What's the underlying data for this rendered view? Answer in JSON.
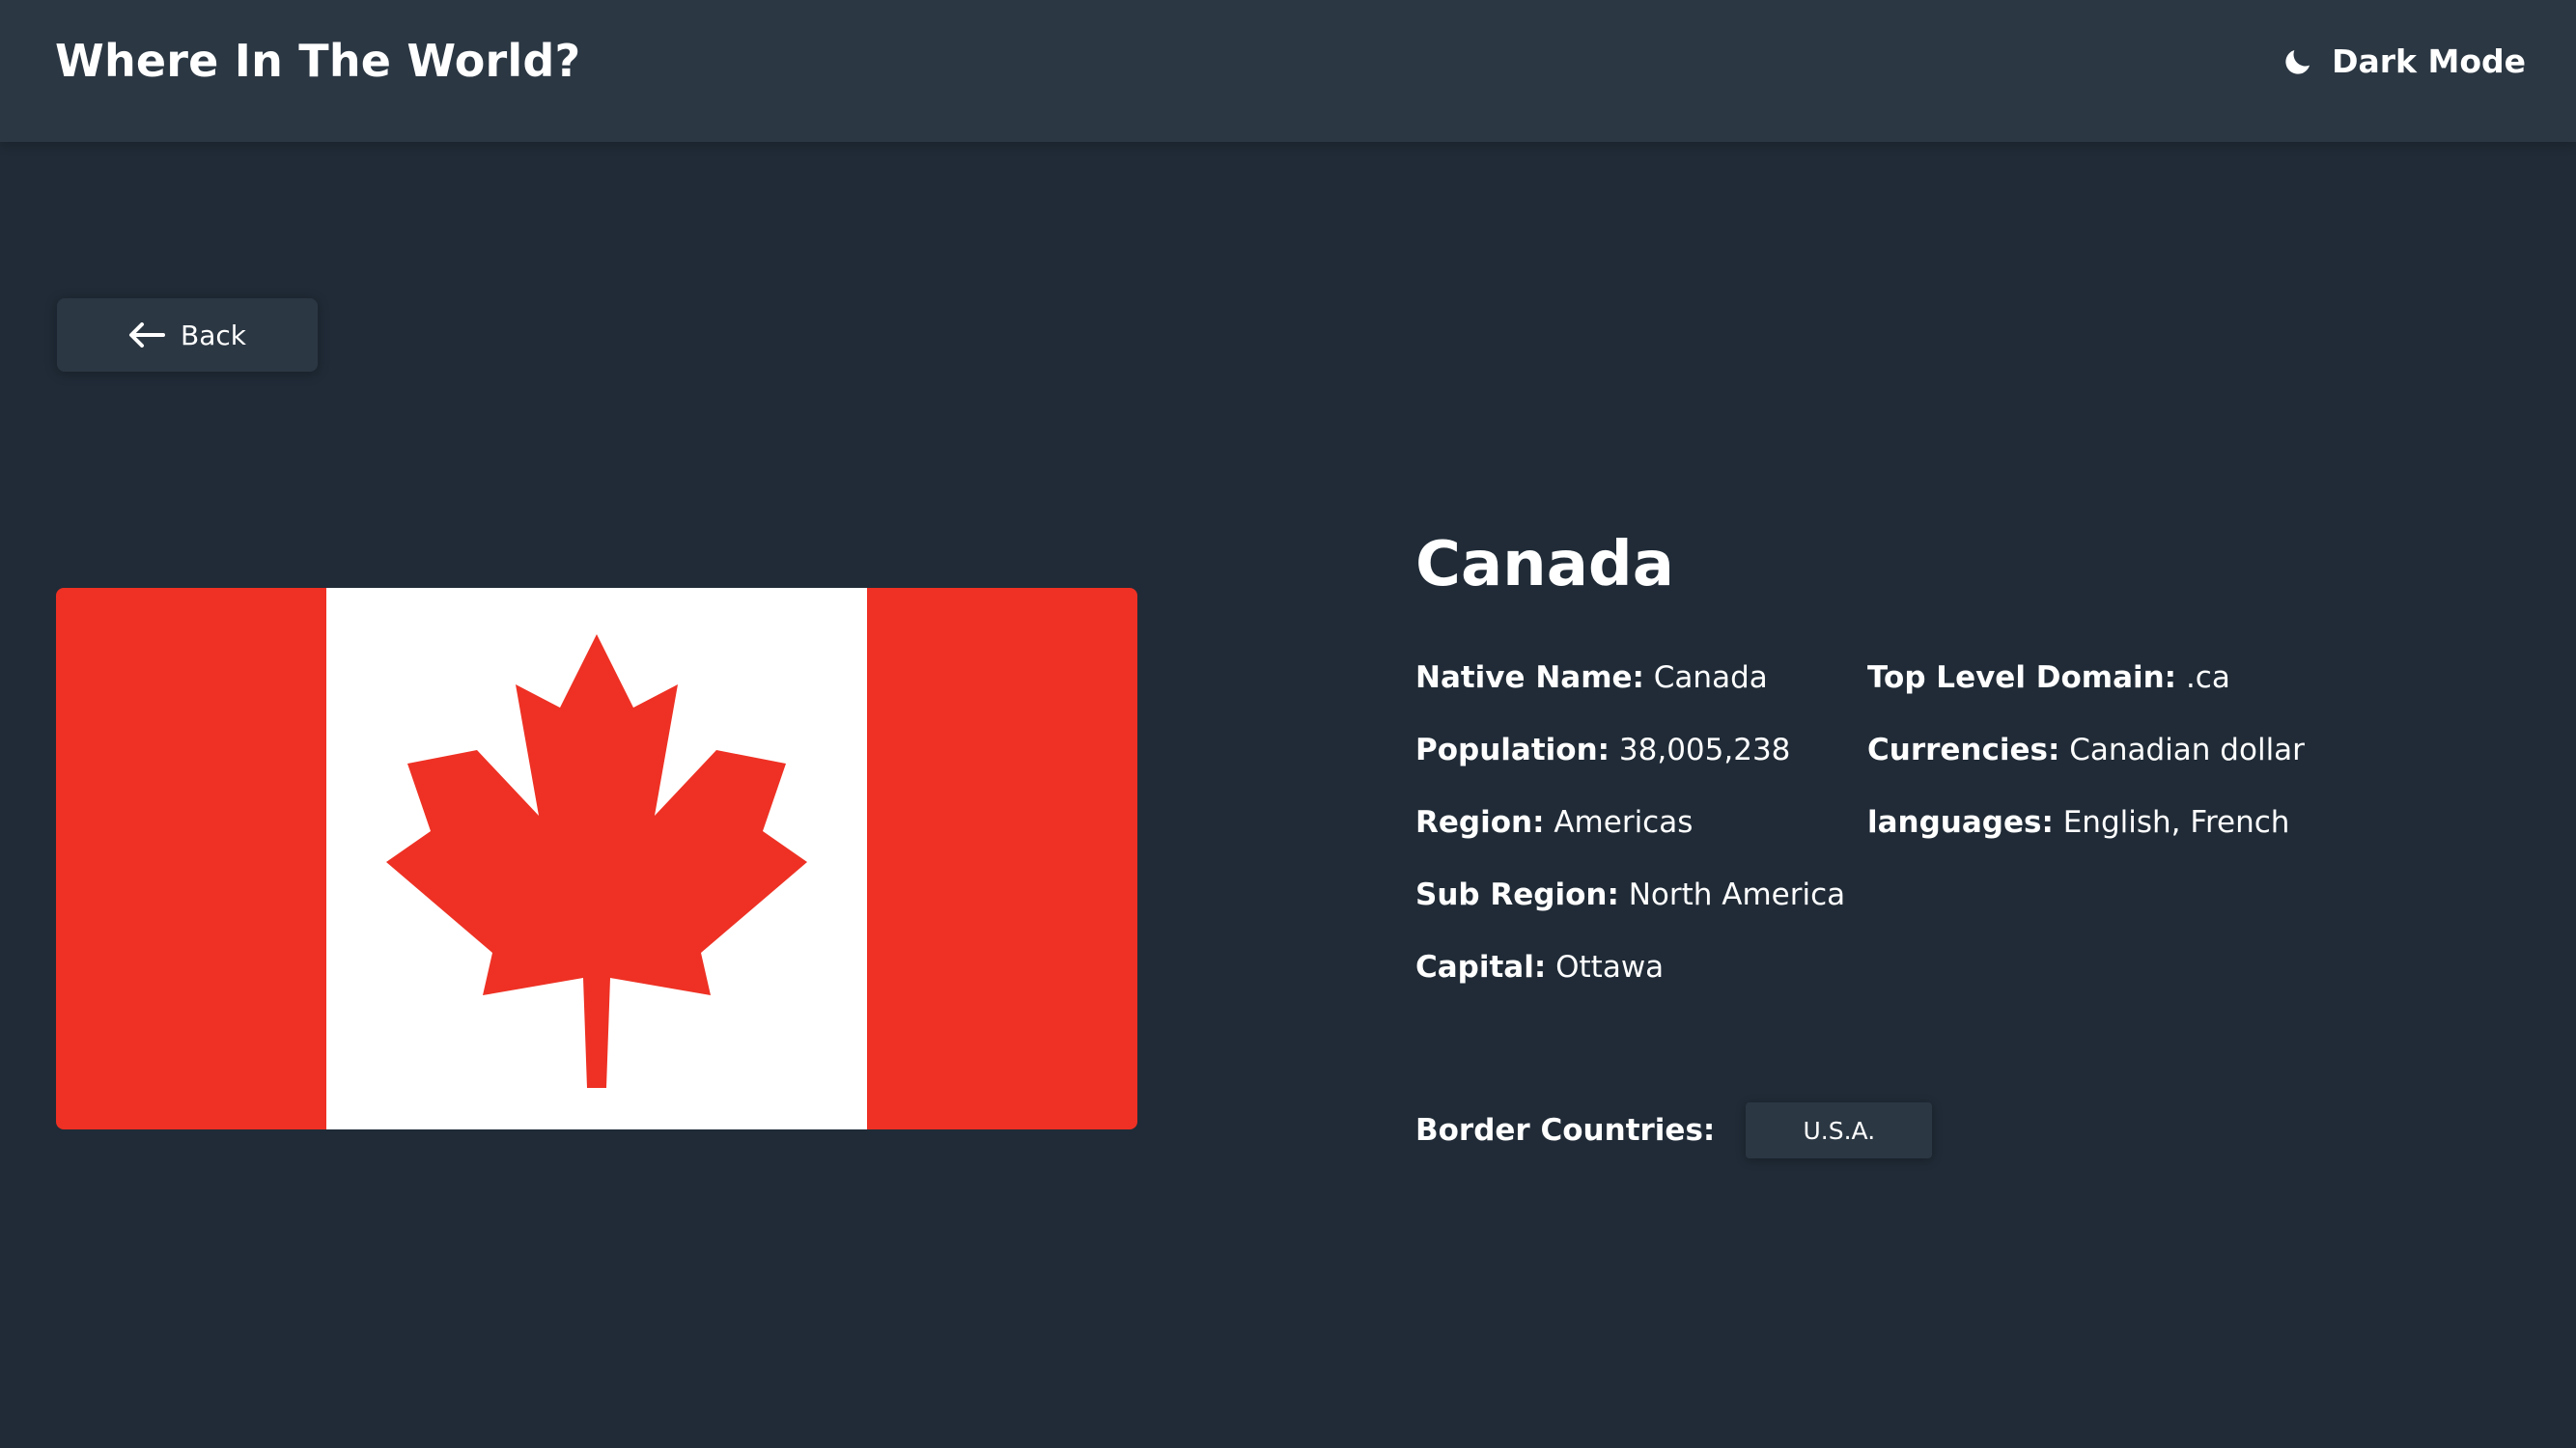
{
  "header": {
    "title": "Where In The World?",
    "theme_label": "Dark Mode",
    "theme_icon": "moon-icon"
  },
  "back_button": {
    "label": "Back",
    "icon": "arrow-left-icon"
  },
  "country": {
    "name": "Canada",
    "flag_icon": "canada-flag",
    "details_left": [
      {
        "key": "Native Name:",
        "value": "Canada"
      },
      {
        "key": "Population:",
        "value": "38,005,238"
      },
      {
        "key": "Region:",
        "value": "Americas"
      },
      {
        "key": "Sub Region:",
        "value": "North America"
      },
      {
        "key": "Capital:",
        "value": "Ottawa"
      }
    ],
    "details_right": [
      {
        "key": "Top Level Domain:",
        "value": ".ca"
      },
      {
        "key": "Currencies:",
        "value": "Canadian dollar"
      },
      {
        "key": "languages:",
        "value": "English, French"
      }
    ],
    "border_title": "Border Countries:",
    "border_countries": [
      "U.S.A."
    ]
  },
  "colors": {
    "background": "#202b37",
    "surface": "#2b3743",
    "text": "#ffffff",
    "flag_red": "#ee3124",
    "flag_white": "#ffffff"
  }
}
